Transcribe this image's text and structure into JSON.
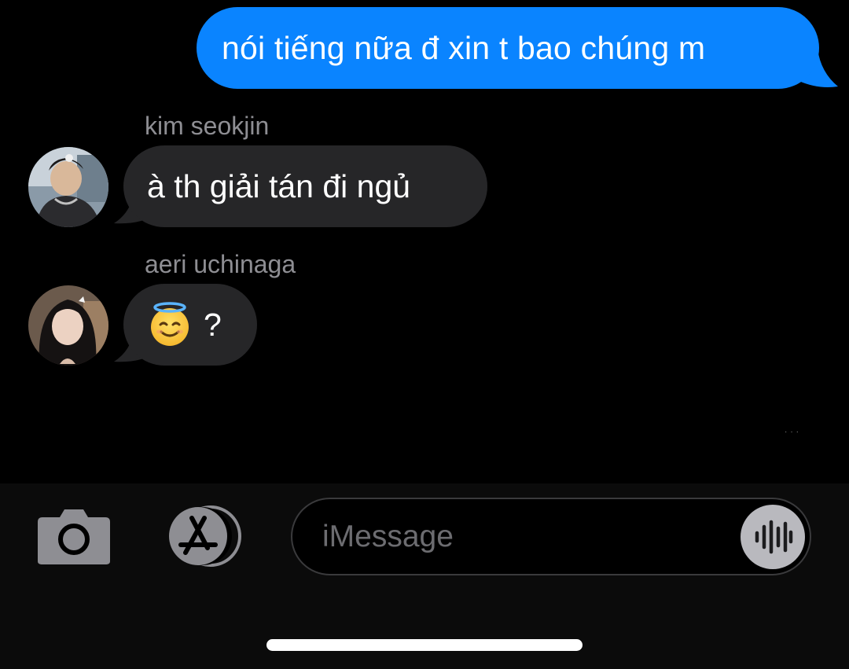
{
  "thread": {
    "outgoing": [
      {
        "text": "nói tiếng nữa đ xin t bao chúng m"
      }
    ],
    "incoming": [
      {
        "sender": "kim seokjin",
        "text": "à th giải tán đi ngủ",
        "avatar_icon": "avatar-photo"
      },
      {
        "sender": "aeri uchinaga",
        "emoji": "smiling-face-with-halo",
        "text": "?",
        "avatar_icon": "avatar-photo"
      }
    ]
  },
  "compose": {
    "placeholder": "iMessage",
    "value": "",
    "camera_icon": "camera-icon",
    "apps_icon": "app-store-icon",
    "audio_icon": "audio-waveform-icon"
  },
  "colors": {
    "outgoing_bubble": "#0a84ff",
    "incoming_bubble": "#262628",
    "sender_label": "#8e8e93",
    "background": "#000000"
  }
}
